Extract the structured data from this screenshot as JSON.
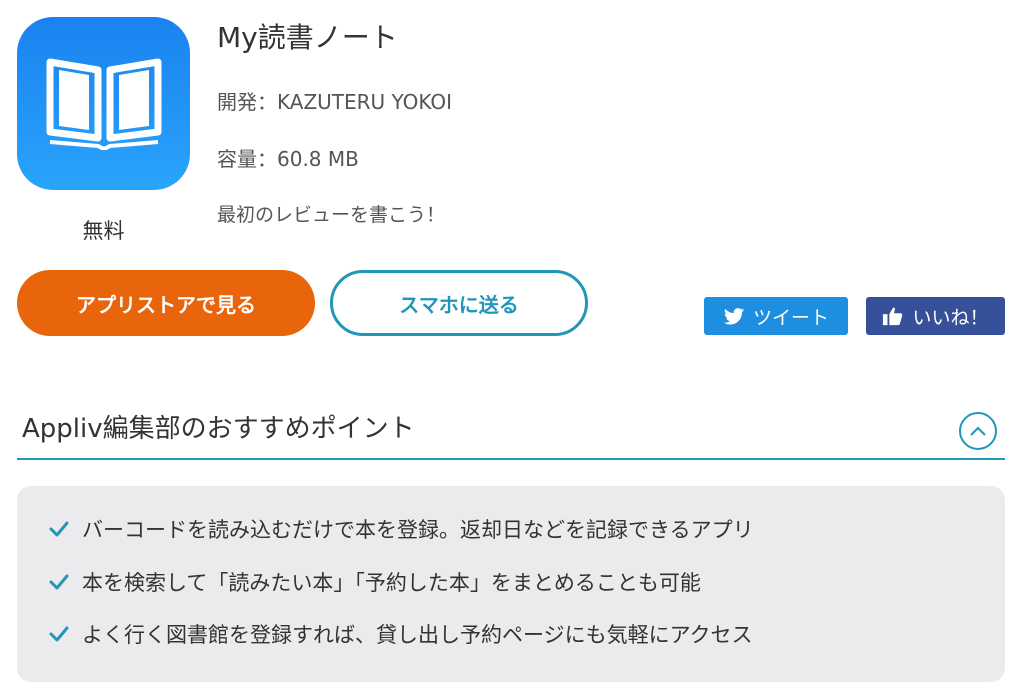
{
  "app": {
    "title": "My読書ノート",
    "developer": "開発：KAZUTERU YOKOI",
    "size": "容量：60.8 MB",
    "review_prompt": "最初のレビューを書こう！",
    "price": "無料",
    "icon": "open-book-icon"
  },
  "actions": {
    "store_label": "アプリストアで見る",
    "send_label": "スマホに送る",
    "tweet_label": "ツイート",
    "like_label": "いいね！"
  },
  "recommend": {
    "title": "Appliv編集部のおすすめポイント",
    "points": [
      "バーコードを読み込むだけで本を登録。返却日などを記録できるアプリ",
      "本を検索して「読みたい本」「予約した本」をまとめることも可能",
      "よく行く図書館を登録すれば、貸し出し予約ページにも気軽にアクセス"
    ]
  },
  "colors": {
    "accent_orange": "#e8650c",
    "accent_blue": "#2196b9",
    "twitter_blue": "#1d8ee0",
    "facebook_blue": "#36509a",
    "icon_gradient_top": "#1a82f0",
    "icon_gradient_bottom": "#2aa4fb"
  }
}
